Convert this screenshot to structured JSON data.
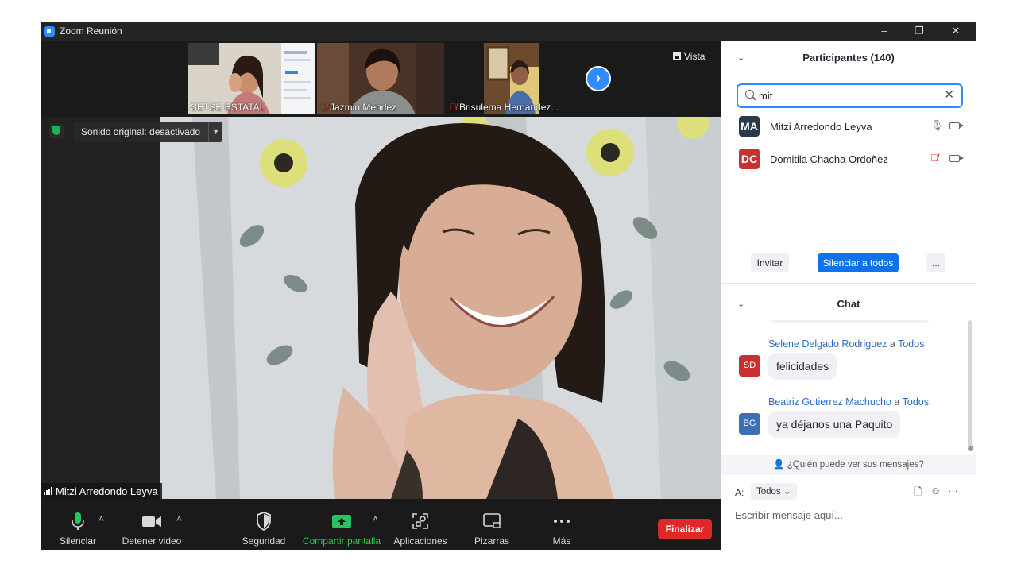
{
  "window": {
    "title": "Zoom Reunión",
    "minimize": "–",
    "restore": "❐",
    "close": "✕"
  },
  "thumbnails": [
    {
      "name": "SETSE ESTATAL",
      "muted": false
    },
    {
      "name": "Jazmin Méndez",
      "muted": true
    },
    {
      "name": "Brisulema Hernandez...",
      "muted": true
    }
  ],
  "view": {
    "label": "Vista"
  },
  "main_video": {
    "audio_status": "Sonido original: desactivado",
    "speaker": "Mitzi Arredondo Leyva"
  },
  "toolbar": {
    "mute": "Silenciar",
    "video": "Detener video",
    "security": "Seguridad",
    "share": "Compartir pantalla",
    "apps": "Aplicaciones",
    "whiteboards": "Pizarras",
    "more": "Más",
    "end": "Finalizar"
  },
  "participants": {
    "title": "Participantes (140)",
    "search_value": "mit",
    "list": [
      {
        "initials": "MA",
        "name": "Mitzi Arredondo Leyva",
        "color": "#2b3a4a",
        "muted": false
      },
      {
        "initials": "DC",
        "name": "Domitila Chacha Ordoñez",
        "color": "#c8312f",
        "muted": true
      }
    ],
    "invite": "Invitar",
    "mute_all": "Silenciar a todos",
    "more": "..."
  },
  "chat": {
    "title": "Chat",
    "to_word": "a",
    "messages": [
      {
        "sender": "Selene Delgado Rodriguez",
        "recipient": "Todos",
        "initials": "SD",
        "color": "#c8312f",
        "text": "felicidades"
      },
      {
        "sender": "Beatriz Gutierrez Machucho",
        "recipient": "Todos",
        "initials": "BG",
        "color": "#3b6fb6",
        "text": "ya déjanos una Paquito"
      }
    ],
    "who_can_see": "¿Quién puede ver sus mensajes?",
    "to_label": "A:",
    "to_value": "Todos",
    "placeholder": "Escribir mensaje aquí..."
  }
}
